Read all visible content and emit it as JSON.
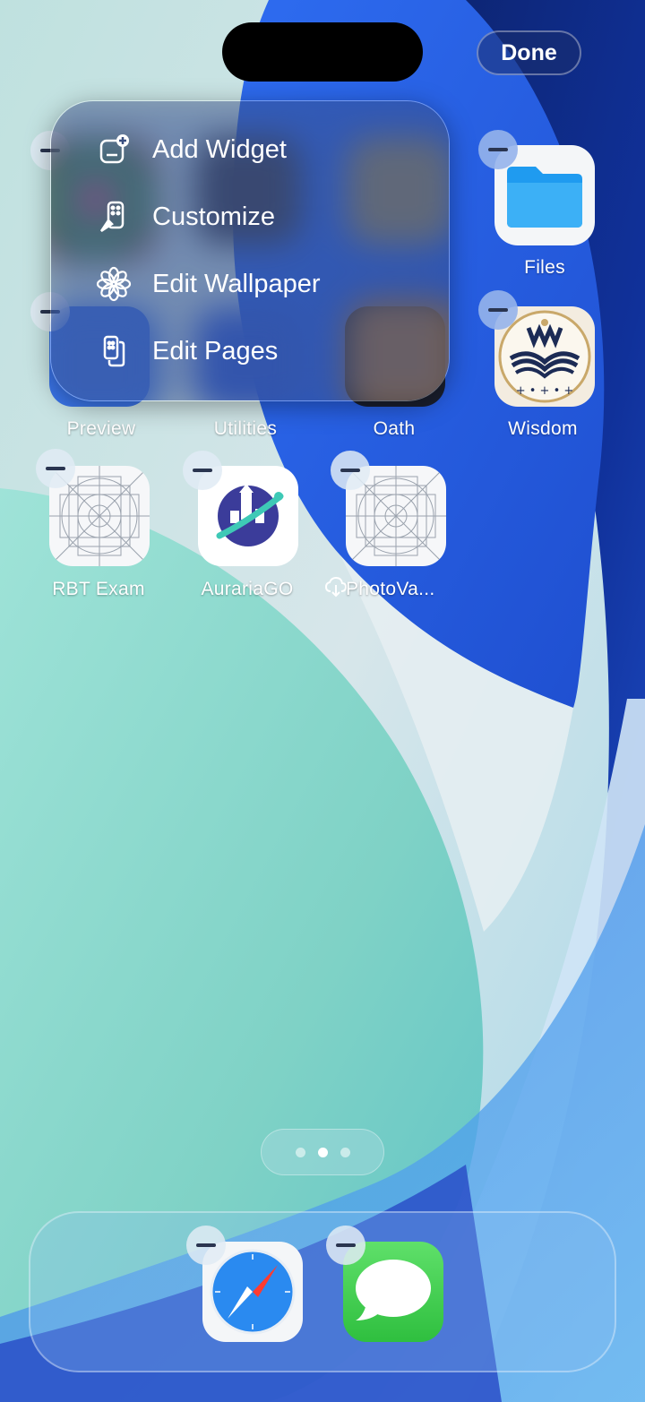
{
  "header": {
    "done_label": "Done"
  },
  "context_menu": {
    "items": [
      {
        "label": "Add Widget",
        "icon": "add-widget-icon"
      },
      {
        "label": "Customize",
        "icon": "customize-icon"
      },
      {
        "label": "Edit Wallpaper",
        "icon": "edit-wallpaper-icon"
      },
      {
        "label": "Edit Pages",
        "icon": "edit-pages-icon"
      }
    ]
  },
  "home": {
    "row1": [
      {
        "label": "Files",
        "icon": "files-icon"
      }
    ],
    "row2": [
      {
        "label": "Preview",
        "icon": "preview-icon"
      },
      {
        "label": "Utilities",
        "icon": "utilities-folder-icon"
      },
      {
        "label": "Oath",
        "icon": "oath-icon"
      },
      {
        "label": "Wisdom",
        "icon": "wisdom-icon"
      }
    ],
    "row3": [
      {
        "label": "RBT Exam",
        "icon": "placeholder-app-icon"
      },
      {
        "label": "AurariaGO",
        "icon": "auraria-go-icon"
      },
      {
        "label": "PhotoVa...",
        "icon": "placeholder-app-icon",
        "status_icon": "icloud-download-icon"
      }
    ]
  },
  "page_dots": {
    "count": 3,
    "active_index": 1
  },
  "dock": {
    "apps": [
      {
        "label": "Safari",
        "icon": "safari-icon"
      },
      {
        "label": "Messages",
        "icon": "messages-icon"
      }
    ]
  },
  "colors": {
    "wallpaper_blue": "#2a5ae0",
    "wallpaper_teal": "#8fd8cc",
    "menu_tint": "#37466e",
    "messages_green": "#3fcf4f",
    "files_blue": "#1f9bf0"
  }
}
